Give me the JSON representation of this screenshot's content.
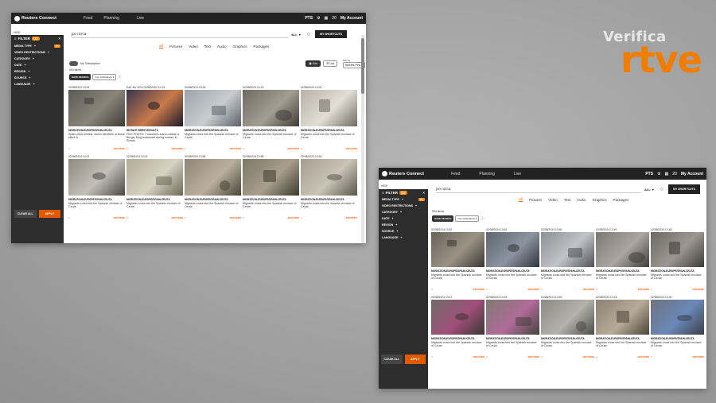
{
  "colors": {
    "accent": "#ff6600",
    "topbar": "#222222",
    "sidebar": "#2d2d2d",
    "brand_rtve": "#f07c00"
  },
  "watermark": {
    "verifica": "Verifica",
    "rtve": "rtve"
  },
  "app": {
    "brand": "Reuters Connect",
    "nav": [
      "Feed",
      "Planning",
      "Live"
    ],
    "pts": "PTS",
    "notif_count": "20",
    "account": "My Account",
    "collapse": "HIDE"
  },
  "sidebar": {
    "filter_label": "FILTER",
    "filter_count": "(1)",
    "items": [
      {
        "label": "MEDIA TYPE",
        "count": "(1)"
      },
      {
        "label": "VIDEO RESTRICTIONS",
        "count": ""
      },
      {
        "label": "CATEGORY",
        "count": ""
      },
      {
        "label": "DATE",
        "count": ""
      },
      {
        "label": "REGION",
        "count": ""
      },
      {
        "label": "SOURCE",
        "count": ""
      },
      {
        "label": "LANGUAGE",
        "count": ""
      }
    ],
    "clear_all": "CLEAR ALL",
    "apply": "APPLY"
  },
  "search": {
    "value": "jon rozca",
    "scope": "ALL",
    "shortcuts": "MY SHORTCUTS"
  },
  "tabs": [
    "All",
    "Pictures",
    "Video",
    "Text",
    "Audio",
    "Graphics",
    "Packages"
  ],
  "subscription": "My Subscription",
  "sort_by_label": "Sort by",
  "sort_by_value": "Newest First",
  "view_grid": "Grid",
  "view_list": "List",
  "items_count": "594 items",
  "save_search": "SAVE SEARCH",
  "notifications": "Get notifications",
  "shot1": {
    "cards": [
      {
        "date": "02/08/2024 13:43",
        "slug": "MIGRATION-EUROPE/SPAIN-CEUTA",
        "desc": "Spain plans burials, seeks identities of those killed in",
        "src": "REUTERS",
        "badge": ""
      },
      {
        "date": "Edit: fev 2024 02/08/2024 12:19",
        "slug": "INSTANT BRIEF-RESULTS",
        "desc": "FILE PHOTO: Customers stand outside a Burger King restaurant during sunset, in Ronda",
        "src": "REUTERS",
        "badge": ""
      },
      {
        "date": "02/08/2024 15:26",
        "slug": "MIGRATION-EUROPE/SPAIN-CEUTA",
        "desc": "Migrants cross into the Spanish enclave of Ceuta",
        "src": "REUTERS",
        "badge": ""
      },
      {
        "date": "02/08/2024 14:19",
        "slug": "MIGRATION-EUROPE/SPAIN-CEUTA",
        "desc": "Migrants cross into the Spanish enclave of Ceuta",
        "src": "REUTERS",
        "badge": ""
      },
      {
        "date": "02/08/2024 14:02",
        "slug": "MIGRATION-EUROPE/SPAIN-CEUTA",
        "desc": "Migrants cross into the Spanish enclave of Ceuta",
        "src": "REUTERS",
        "badge": ""
      },
      {
        "date": "02/08/2024 14:01",
        "slug": "MIGRATION-EUROPE/SPAIN-CEUTA",
        "desc": "Migrants cross into the Spanish enclave of Ceuta",
        "src": "REUTERS",
        "badge": ""
      },
      {
        "date": "02/08/2024 14:02",
        "slug": "MIGRATION-EUROPE/SPAIN-CEUTA",
        "desc": "Migrants cross into the Spanish enclave of Ceuta",
        "src": "REUTERS",
        "badge": ""
      },
      {
        "date": "02/08/2024 13:58",
        "slug": "MIGRATION-EUROPE/SPAIN-CEUTA",
        "desc": "Migrants cross into the Spanish enclave of Ceuta",
        "src": "REUTERS",
        "badge": ""
      },
      {
        "date": "02/08/2024 13:55",
        "slug": "MIGRATION-EUROPE/SPAIN-CEUTA",
        "desc": "Migrants cross into the Spanish enclave of Ceuta",
        "src": "REUTERS",
        "badge": ""
      },
      {
        "date": "02/08/2024 13:53",
        "slug": "MIGRATION-EUROPE/SPAIN-CEUTA",
        "desc": "Migrants cross into the Spanish enclave of Ceuta",
        "src": "REUTERS",
        "badge": ""
      }
    ]
  },
  "shot2": {
    "cards": [
      {
        "date": "02/08/2024 13:52",
        "slug": "MIGRATION-EUROPE/SPAIN-CEUTA",
        "desc": "Migrants cross into the Spanish enclave of Ceuta",
        "src": "REUTERS"
      },
      {
        "date": "02/08/2024 13:51",
        "slug": "MIGRATION-EUROPE/SPAIN-CEUTA",
        "desc": "Migrants cross into the Spanish enclave of Ceuta",
        "src": "REUTERS"
      },
      {
        "date": "02/08/2024 13:50",
        "slug": "MIGRATION-EUROPE/SPAIN-CEUTA",
        "desc": "Migrants cross into the Spanish enclave of Ceuta",
        "src": "REUTERS"
      },
      {
        "date": "02/08/2024 13:49",
        "slug": "MIGRATION-EUROPE/SPAIN-CEUTA",
        "desc": "Migrants cross into the Spanish enclave of Ceuta",
        "src": "REUTERS"
      },
      {
        "date": "02/08/2024 13:48",
        "slug": "MIGRATION-EUROPE/SPAIN-CEUTA",
        "desc": "Migrants cross into the Spanish enclave of Ceuta",
        "src": "REUTERS"
      },
      {
        "date": "02/08/2024 13:47",
        "slug": "MIGRATION-EUROPE/SPAIN-CEUTA",
        "desc": "Migrants cross into the Spanish enclave of Ceuta",
        "src": "REUTERS"
      },
      {
        "date": "02/08/2024 13:46",
        "slug": "MIGRATION-EUROPE/SPAIN-CEUTA",
        "desc": "Migrants cross into the Spanish enclave of Ceuta",
        "src": "REUTERS"
      },
      {
        "date": "02/08/2024 13:45",
        "slug": "MIGRATION-EUROPE/SPAIN-CEUTA",
        "desc": "Migrants cross into the Spanish enclave of Ceuta",
        "src": "REUTERS"
      },
      {
        "date": "02/08/2024 13:44",
        "slug": "MIGRATION-EUROPE/SPAIN-CEUTA",
        "desc": "Migrants cross into the Spanish enclave of Ceuta",
        "src": "REUTERS"
      },
      {
        "date": "02/08/2024 13:30",
        "slug": "MIGRATION-EUROPE/SPAIN-CEUTA",
        "desc": "Migrants cross into the Spanish enclave of Ceuta",
        "src": "REUTERS"
      }
    ]
  }
}
